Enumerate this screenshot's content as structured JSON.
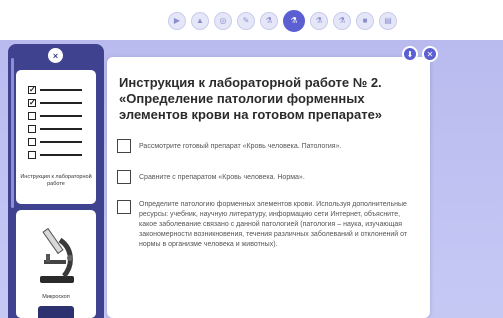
{
  "nav": {
    "icons": [
      "play-icon",
      "graduation-icon",
      "target-icon",
      "pen-icon",
      "flask-icon",
      "flask-icon",
      "flask-icon",
      "flask-icon",
      "video-icon",
      "document-icon"
    ],
    "active_index": 5
  },
  "sidebar": {
    "close_symbol": "×",
    "cards": [
      {
        "caption": "Инструкция к лабораторной работе"
      },
      {
        "caption": "Микроскоп"
      }
    ]
  },
  "panel": {
    "title": "Инструкция к лабораторной работе № 2. «Определение патологии форменных элементов крови на готовом препарате»",
    "tasks": [
      "Рассмотрите готовый препарат «Кровь человека. Патология».",
      "Сравните с препаратом «Кровь человека. Норма».",
      "Определите патологию форменных элементов крови. Используя дополнительные ресурсы: учебник, научную литературу, информацию сети Интернет, объясните, какое заболевание связано с данной патологией (патология – наука, изучающая закономерности возникновения, течения различных заболеваний и отклонений от нормы в организме человека и животных)."
    ]
  },
  "colors": {
    "accent": "#5b5fd1",
    "sidebar": "#3f438f",
    "workspace": "#c1c3f2"
  }
}
